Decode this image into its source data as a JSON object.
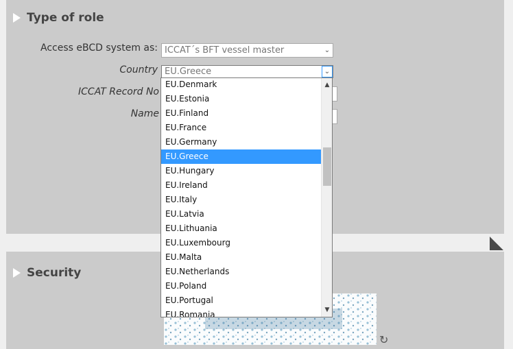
{
  "sections": {
    "role_title": "Type of role",
    "security_title": "Security"
  },
  "form": {
    "access_label": "Access eBCD system as:",
    "access_value": "ICCAT´s BFT vessel master",
    "country_label": "Country",
    "country_value": "EU.Greece",
    "iccat_label": "ICCAT Record No",
    "name_label": "Name"
  },
  "dropdown": {
    "items": [
      "EU.Denmark",
      "EU.Estonia",
      "EU.Finland",
      "EU.France",
      "EU.Germany",
      "EU.Greece",
      "EU.Hungary",
      "EU.Ireland",
      "EU.Italy",
      "EU.Latvia",
      "EU.Lithuania",
      "EU.Luxembourg",
      "EU.Malta",
      "EU.Netherlands",
      "EU.Poland",
      "EU.Portugal",
      "EU.Romania"
    ],
    "selected": "EU.Greece"
  },
  "colors": {
    "panel": "#cbcbcb",
    "selection": "#3399ff",
    "page_bg": "#efefef"
  },
  "icons": {
    "section_toggle": "triangle-right-icon",
    "select_arrow": "chevron-down-icon",
    "captcha_refresh": "refresh-icon"
  }
}
